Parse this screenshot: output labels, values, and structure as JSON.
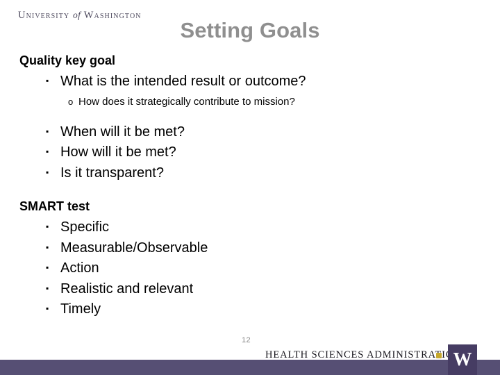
{
  "header": {
    "wordmark_before": "University",
    "wordmark_of": "of",
    "wordmark_after": "Washington",
    "title": "Setting Goals"
  },
  "body": {
    "sections": [
      {
        "heading": "Quality key goal",
        "items": [
          {
            "level": 1,
            "marker": "▪",
            "text": "What is the intended result or outcome?"
          },
          {
            "level": 2,
            "marker": "o",
            "text": "How does it strategically contribute to mission?"
          },
          {
            "level": 1,
            "marker": "▪",
            "text": "When will it be met?"
          },
          {
            "level": 1,
            "marker": "▪",
            "text": "How will it be met?"
          },
          {
            "level": 1,
            "marker": "▪",
            "text": "Is it transparent?"
          }
        ]
      },
      {
        "heading": "SMART test",
        "items": [
          {
            "level": 1,
            "marker": "▪",
            "text": "Specific"
          },
          {
            "level": 1,
            "marker": "▪",
            "text": "Measurable/Observable"
          },
          {
            "level": 1,
            "marker": "▪",
            "text": "Action"
          },
          {
            "level": 1,
            "marker": "▪",
            "text": "Realistic and relevant"
          },
          {
            "level": 1,
            "marker": "▪",
            "text": "Timely"
          }
        ]
      }
    ]
  },
  "page_number": "12",
  "footer": {
    "unit_name": "Health Sciences Administration",
    "badge_letter": "W"
  },
  "colors": {
    "title_gray": "#8f8f8f",
    "band_purple": "#564f74",
    "badge_purple": "#463c63",
    "accent_gold": "#c6a82c",
    "wordmark_gray": "#4e4a5e",
    "page_number_gray": "#8a8a8a",
    "background": "#ffffff"
  }
}
